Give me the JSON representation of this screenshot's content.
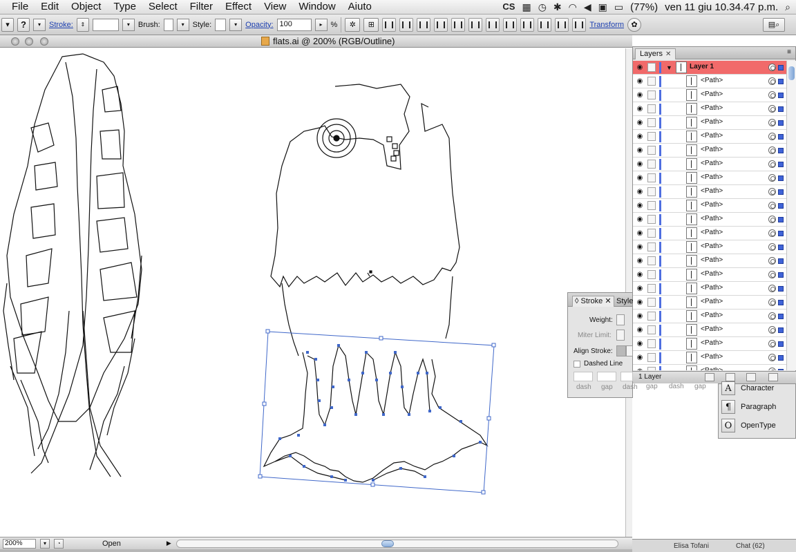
{
  "menubar": {
    "items": [
      "File",
      "Edit",
      "Object",
      "Type",
      "Select",
      "Filter",
      "Effect",
      "View",
      "Window",
      "Aiuto"
    ],
    "battery": "(77%)",
    "datetime": "ven 11 giu  10.34.47 p.m."
  },
  "controlbar": {
    "question": "?",
    "stroke_label": "Stroke:",
    "brush_label": "Brush:",
    "style_label": "Style:",
    "opacity_label": "Opacity:",
    "opacity_value": "100",
    "percent": "%",
    "transform_label": "Transform"
  },
  "document": {
    "title": "flats.ai @ 200% (RGB/Outline)"
  },
  "statusbar": {
    "zoom": "200%",
    "status": "Open"
  },
  "layers_panel": {
    "tab": "Layers",
    "layer_name": "Layer 1",
    "path_label": "<Path>",
    "path_count": 22,
    "footer": "1 Layer"
  },
  "stroke_panel": {
    "tab": "Stroke",
    "tab2": "Style",
    "weight_label": "Weight:",
    "miter_label": "Miter Limit:",
    "align_label": "Align Stroke:",
    "dashed_label": "Dashed Line",
    "dash_labels": [
      "dash",
      "gap",
      "dash",
      "gap",
      "dash",
      "gap"
    ]
  },
  "type_panel": {
    "items": [
      {
        "label": "Character",
        "icon": "character-icon"
      },
      {
        "label": "Paragraph",
        "icon": "paragraph-icon"
      },
      {
        "label": "OpenType",
        "icon": "opentype-icon"
      }
    ]
  },
  "dock": {
    "item1": "Elisa Tofani",
    "item2": "Chat (62)"
  }
}
